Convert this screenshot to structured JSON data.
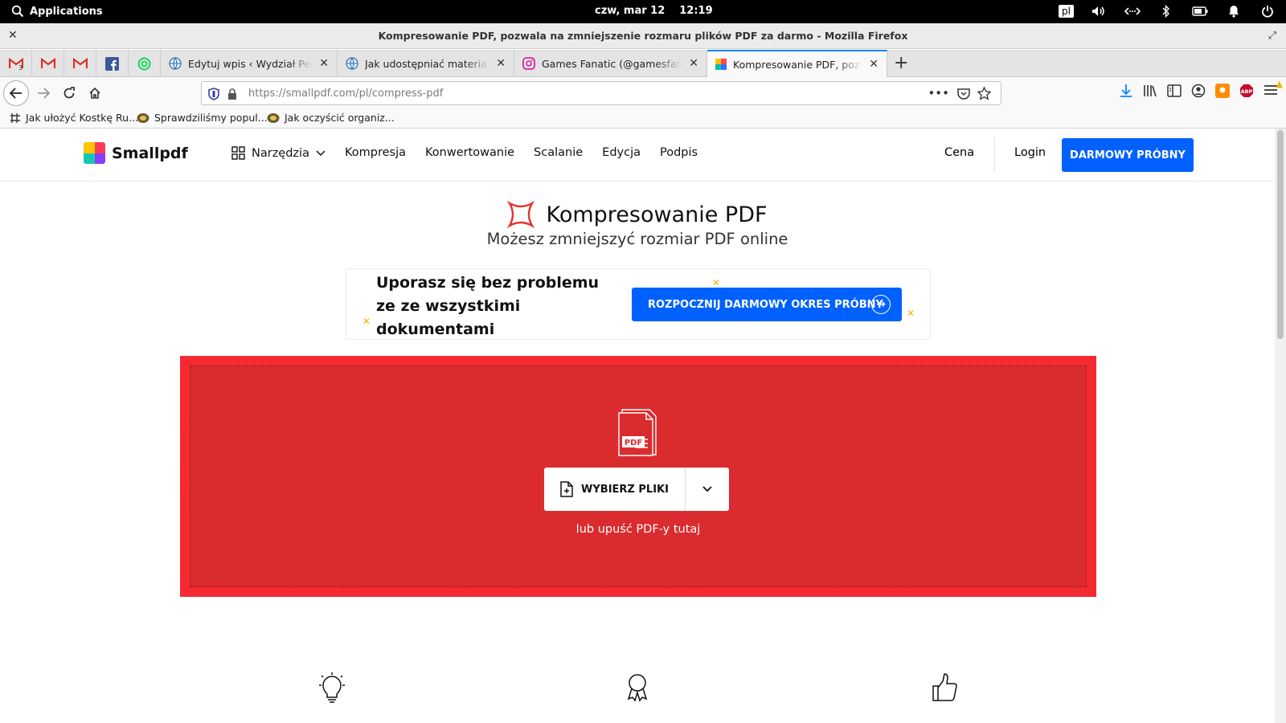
{
  "system": {
    "apps_label": "Applications",
    "date": "czw, mar 12",
    "time": "12:19",
    "lang": "pl"
  },
  "window": {
    "title": "Kompresowanie PDF, pozwala na zmniejszenie rozmaru plików PDF za darmo - Mozilla Firefox"
  },
  "tabs": [
    {
      "label": "Edytuj wpis ‹ Wydział Pedagogiczny"
    },
    {
      "label": "Jak udostępniać materiały dla"
    },
    {
      "label": "Games Fanatic (@gamesfanatic)"
    },
    {
      "label": "Kompresowanie PDF, pozwala"
    }
  ],
  "pinned": {
    "gmail_badge": "3"
  },
  "nav": {
    "url_host": "https://smallpdf.com",
    "url_path": "/pl/compress-pdf"
  },
  "bookmarks": [
    {
      "label": "Jak ułożyć Kostkę Ru..."
    },
    {
      "label": "Sprawdziliśmy popul..."
    },
    {
      "label": "Jak oczyścić organiz..."
    }
  ],
  "site": {
    "logo": "Smallpdf",
    "menu": {
      "tools": "Narzędzia",
      "items": [
        "Kompresja",
        "Konwertowanie",
        "Scalanie",
        "Edycja",
        "Podpis"
      ]
    },
    "price": "Cena",
    "login": "Login",
    "trial": "DARMOWY PRÓBNY"
  },
  "main": {
    "title": "Kompresowanie PDF",
    "subtitle": "Możesz zmniejszyć rozmiar PDF online",
    "banner_text": "Uporasz się bez problemu ze ze wszystkimi dokumentami",
    "banner_cta": "ROZPOCZNIJ DARMOWY OKRES PRÓBNY",
    "pdf_label": "PDF",
    "choose_files": "WYBIERZ PLIKI",
    "drop_hint": "lub upuść PDF-y tutaj"
  },
  "colors": {
    "brand_blue": "#0061fe",
    "drop_red": "#da2b2f",
    "drop_border": "#f52a30"
  }
}
